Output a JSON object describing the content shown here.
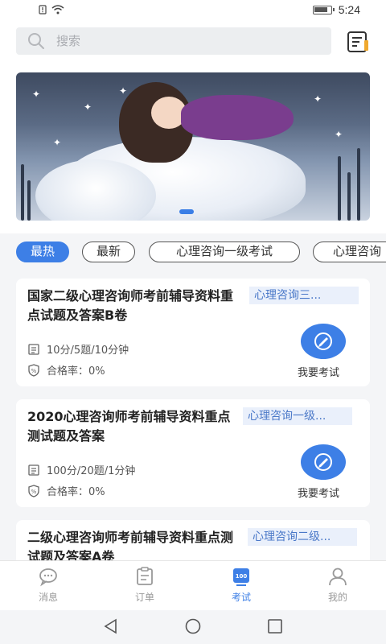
{
  "status_bar": {
    "time": "5:24"
  },
  "search": {
    "placeholder": "搜索"
  },
  "filter_tabs": [
    {
      "label": "最热",
      "active": true
    },
    {
      "label": "最新",
      "active": false
    },
    {
      "label": "心理咨询一级考试",
      "active": false
    },
    {
      "label": "心理咨询",
      "active": false
    }
  ],
  "exams": [
    {
      "title": "国家二级心理咨询师考前辅导资料重点试题及答案B卷",
      "tag": "心理咨询三...",
      "info": "10分/5题/10分钟",
      "pass_rate": "合格率：0%",
      "button_label": "我要考试"
    },
    {
      "title": "2020心理咨询师考前辅导资料重点测试题及答案",
      "tag": "心理咨询一级...",
      "info": "100分/20题/1分钟",
      "pass_rate": "合格率：0%",
      "button_label": "我要考试"
    },
    {
      "title": "二级心理咨询师考前辅导资料重点测试题及答案A卷",
      "tag": "心理咨询二级...",
      "info": "",
      "pass_rate": "",
      "button_label": ""
    }
  ],
  "bottom_nav": [
    {
      "label": "消息",
      "icon": "message-icon",
      "active": false
    },
    {
      "label": "订单",
      "icon": "order-icon",
      "active": false
    },
    {
      "label": "考试",
      "icon": "exam-icon",
      "active": true
    },
    {
      "label": "我的",
      "icon": "profile-icon",
      "active": false
    }
  ],
  "colors": {
    "accent": "#3d7fe6",
    "tag_bg": "#eaf0fb",
    "tag_text": "#4a78c8"
  }
}
